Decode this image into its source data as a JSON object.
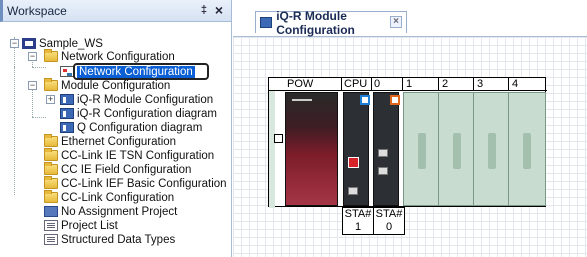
{
  "workspace": {
    "title": "Workspace",
    "pin_glyph": "‡",
    "close_glyph": "×"
  },
  "tree": {
    "items": [
      {
        "label": "Sample_WS",
        "icon": "project-icon"
      },
      {
        "label": "Network Configuration",
        "icon": "folder-icon"
      },
      {
        "label": "Network Configuration",
        "icon": "network-config-icon",
        "selected": true
      },
      {
        "label": "Module Configuration",
        "icon": "folder-icon"
      },
      {
        "label": "iQ-R Module Configuration",
        "icon": "module-config-icon"
      },
      {
        "label": "iQ-R Configuration diagram",
        "icon": "module-config-icon"
      },
      {
        "label": "Q Configuration diagram",
        "icon": "module-config-icon"
      },
      {
        "label": "Ethernet Configuration",
        "icon": "folder-icon"
      },
      {
        "label": "CC-Link IE TSN Configuration",
        "icon": "folder-icon"
      },
      {
        "label": "CC IE Field Configuration",
        "icon": "folder-icon"
      },
      {
        "label": "CC-Link IEF Basic Configuration",
        "icon": "folder-icon"
      },
      {
        "label": "CC-Link Configuration",
        "icon": "folder-icon"
      },
      {
        "label": "No Assignment Project",
        "icon": "no-assignment-icon"
      },
      {
        "label": "Project List",
        "icon": "list-icon"
      },
      {
        "label": "Structured Data Types",
        "icon": "list-icon"
      }
    ]
  },
  "editor": {
    "tab_label": "iQ-R Module Configuration",
    "tab_close": "×",
    "rack": {
      "slot_labels": [
        "POW",
        "CPU",
        "0",
        "1",
        "2",
        "3",
        "4"
      ],
      "sta": [
        {
          "line1": "STA#",
          "line2": "1"
        },
        {
          "line1": "STA#",
          "line2": "0"
        }
      ]
    }
  },
  "colors": {
    "selection": "#0a5fd4",
    "power_module": "#a53545",
    "cpu_accent_blue": "#1d7fd6",
    "cpu_accent_orange": "#e0661c",
    "empty_slot": "#c9dcd0"
  }
}
